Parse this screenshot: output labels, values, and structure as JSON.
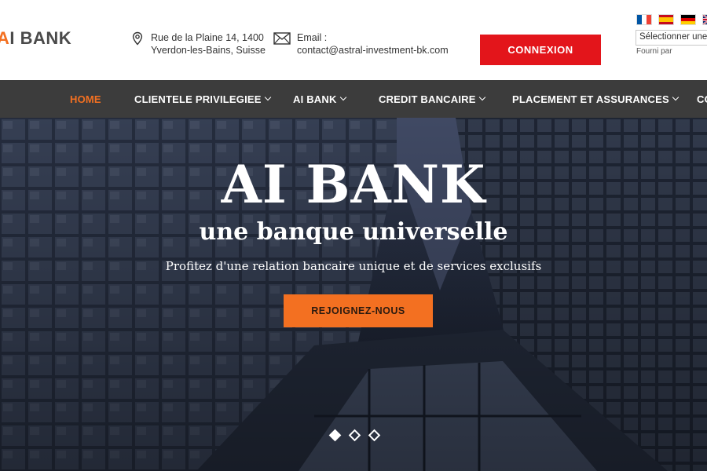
{
  "header": {
    "logo_text": "AI BANK",
    "address_line1": "Rue de la Plaine 14, 1400",
    "address_line2": "Yverdon-les-Bains, Suisse",
    "email_label": "Email :",
    "email_value": "contact@astral-investment-bk.com",
    "login_label": "CONNEXION",
    "language_select": "Sélectionner une",
    "powered_by": "Fourni par",
    "flags": [
      "fr-flag-icon",
      "es-flag-icon",
      "de-flag-icon",
      "uk-flag-icon"
    ]
  },
  "nav": {
    "items": [
      {
        "label": "HOME",
        "active": true
      },
      {
        "label": "CLIENTELE PRIVILEGIEE",
        "dropdown": true
      },
      {
        "label": "AI BANK",
        "dropdown": true
      },
      {
        "label": "CREDIT BANCAIRE",
        "dropdown": true
      },
      {
        "label": "PLACEMENT ET ASSURANCES",
        "dropdown": true
      },
      {
        "label": "CO"
      }
    ]
  },
  "hero": {
    "title": "AI BANK",
    "subtitle": "une banque universelle",
    "tagline": "Profitez d'une relation bancaire unique et de services exclusifs",
    "cta_label": "REJOIGNEZ-NOUS",
    "slides": 3,
    "active_slide": 1
  },
  "colors": {
    "accent": "#f37021",
    "login_red": "#e3151b",
    "nav_bg": "#3c3c3c"
  }
}
